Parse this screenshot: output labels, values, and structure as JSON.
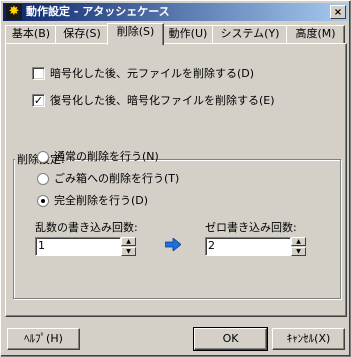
{
  "window": {
    "title": "動作設定 - アタッシェケース",
    "app_icon": "atashe-case-icon",
    "close_glyph": "×"
  },
  "tabs": [
    {
      "label": "基本(B)",
      "active": false
    },
    {
      "label": "保存(S)",
      "active": false
    },
    {
      "label": "削除(S)",
      "active": true
    },
    {
      "label": "動作(U)",
      "active": false
    },
    {
      "label": "システム(Y)",
      "active": false
    },
    {
      "label": "高度(M)",
      "active": false
    }
  ],
  "options": {
    "delete_original": {
      "label": "暗号化した後、元ファイルを削除する(D)",
      "checked": false
    },
    "delete_encrypted": {
      "label": "復号化した後、暗号化ファイルを削除する(E)",
      "checked": true
    }
  },
  "delete_settings": {
    "title": "削除設定:",
    "radios": [
      {
        "label": "通常の削除を行う(N)",
        "selected": false
      },
      {
        "label": "ごみ箱への削除を行う(T)",
        "selected": false
      },
      {
        "label": "完全削除を行う(D)",
        "selected": true
      }
    ],
    "random_label": "乱数の書き込み回数:",
    "random_value": "1",
    "zero_label": "ゼロ書き込み回数:",
    "zero_value": "2"
  },
  "buttons": {
    "help": "ﾍﾙﾌﾟ(H)",
    "ok": "OK",
    "cancel": "ｷｬﾝｾﾙ(X)"
  },
  "colors": {
    "title_start": "#0a246a",
    "title_end": "#a6caf0",
    "face": "#d4d0c8",
    "arrow": "#1e6fd9"
  }
}
